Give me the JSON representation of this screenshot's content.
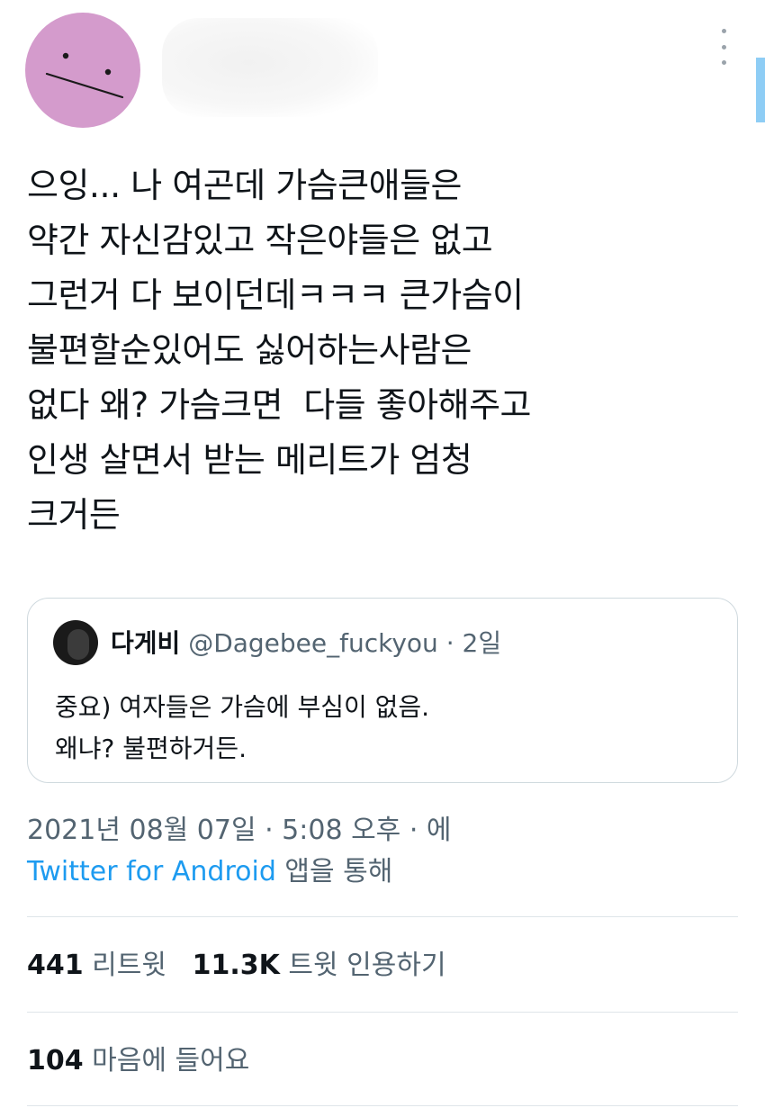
{
  "tweet": {
    "text": "으잉... 나 여곤데 가슴큰애들은\n약간 자신감있고 작은야들은 없고\n그런거 다 보이던데ㅋㅋㅋ 큰가슴이\n불편할순있어도 싫어하는사람은\n없다 왜? 가슴크면  다들 좋아해주고\n인생 살면서 받는 메리트가 엄청\n크거든",
    "avatar_icon": "meh-face-avatar",
    "more_icon": "more-vertical-icon"
  },
  "quote": {
    "name": "다게비",
    "handle": "@Dagebee_fuckyou",
    "separator": "·",
    "time": "2일",
    "text": "중요) 여자들은 가슴에 부심이 없음.\n왜냐? 불편하거든."
  },
  "meta": {
    "timestamp": "2021년 08월 07일 · 5:08 오후 · 에",
    "source": "Twitter for Android",
    "source_suffix": " 앱을 통해"
  },
  "stats": {
    "retweets_count": "441",
    "retweets_label": "리트윗",
    "quotes_count": "11.3K",
    "quotes_label": "트윗 인용하기",
    "likes_count": "104",
    "likes_label": "마음에 들어요"
  },
  "colors": {
    "avatar_bg": "#d49bcc",
    "link": "#1d9bf0",
    "muted": "#536471"
  }
}
